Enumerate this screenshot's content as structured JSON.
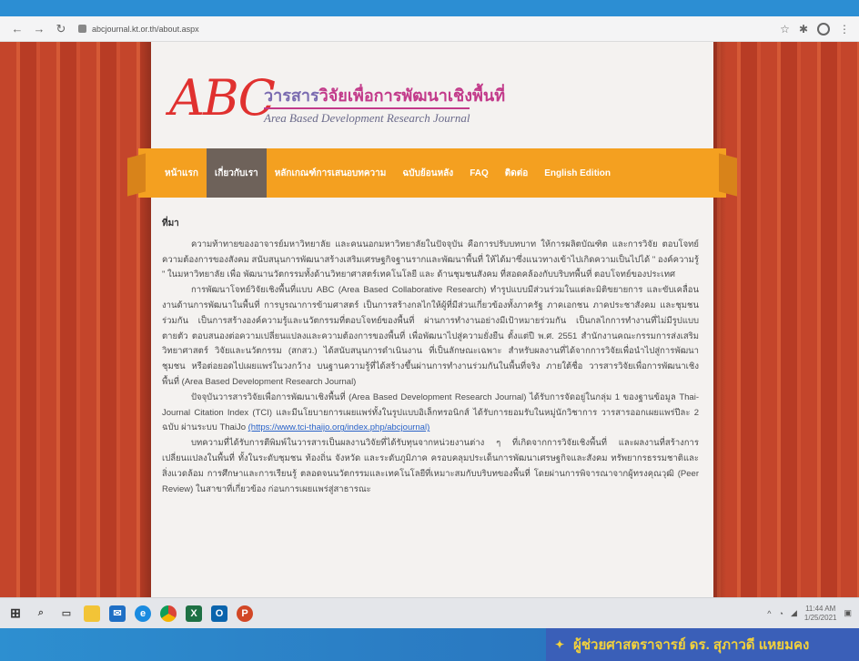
{
  "browser": {
    "back_icon": "back-arrow-icon",
    "forward_icon": "forward-arrow-icon",
    "reload_icon": "reload-icon",
    "url": "abcjournal.kt.or.th/about.aspx",
    "star_icon": "star-icon",
    "extension_icon": "extension-icon",
    "profile_icon": "profile-icon"
  },
  "site": {
    "logo_text": "ABC",
    "title_prefix": "วารสาร",
    "title_main": "วิจัยเพื่อการพัฒนาเชิงพื้นที่",
    "title_en": "Area Based Development Research Journal"
  },
  "menu": {
    "items": [
      "หน้าแรก",
      "เกี่ยวกับเรา",
      "หลักเกณฑ์การเสนอบทความ",
      "ฉบับย้อนหลัง",
      "FAQ",
      "ติดต่อ",
      "English Edition"
    ],
    "active_index": 1
  },
  "content": {
    "heading": "ที่มา",
    "p1": "ความท้าทายของอาจารย์มหาวิทยาลัย และคนนอกมหาวิทยาลัยในปัจจุบัน คือการปรับบทบาท ให้การผลิตบัณฑิต และการวิจัย ตอบโจทย์ความต้องการของสังคม สนับสนุนการพัฒนาสร้างเสริมเศรษฐกิจฐานรากและพัฒนาพื้นที่ ให้ได้มาซึ่งแนวทางเข้าไปเกิดความเป็นไปได้ \" องค์ความรู้ \" ในมหาวิทยาลัย เพื่อ พัฒนานวัตกรรมทั้งด้านวิทยาศาสตร์เทคโนโลยี และ ด้านชุมชนสังคม ที่สอดคล้องกับบริบทพื้นที่ ตอบโจทย์ของประเทศ",
    "p2": "การพัฒนาโจทย์วิจัยเชิงพื้นที่แบบ ABC (Area Based Collaborative Research) ทำรูปแบบมีส่วนร่วมในแต่ละมิติขยายการ และขับเคลื่อน งานด้านการพัฒนาในพื้นที่ การบูรณาการข้ามศาสตร์ เป็นการสร้างกลไกให้ผู้ที่มีส่วนเกี่ยวข้องทั้งภาครัฐ ภาคเอกชน ภาคประชาสังคม และชุมชนร่วมกัน เป็นการสร้างองค์ความรู้และนวัตกรรมที่ตอบโจทย์ของพื้นที่ ผ่านการทำงานอย่างมีเป้าหมายร่วมกัน เป็นกลไกการทำงานที่ไม่มีรูปแบบตายตัว ตอบสนองต่อความเปลี่ยนแปลงและความต้องการของพื้นที่ เพื่อพัฒนาไปสู่ความยั่งยืน ตั้งแต่ปี พ.ศ. 2551 สำนักงานคณะกรรมการส่งเสริมวิทยาศาสตร์ วิจัยและนวัตกรรม (สกสว.) ได้สนับสนุนการดำเนินงาน ที่เป็นลักษณะเฉพาะ สำหรับผลงานที่ได้จากการวิจัยเพื่อนำไปสู่การพัฒนาชุมชน หรือต่อยอดไปเผยแพร่ในวงกว้าง บนฐานความรู้ที่ได้สร้างขึ้นผ่านการทำงานร่วมกันในพื้นที่จริง ภายใต้ชื่อ วารสารวิจัยเพื่อการพัฒนาเชิงพื้นที่ (Area Based Development Research Journal)",
    "p3_before": "ปัจจุบันวารสารวิจัยเพื่อการพัฒนาเชิงพื้นที่ (Area Based Development Research Journal) ได้รับการจัดอยู่ในกลุ่ม 1 ของฐานข้อมูล Thai-Journal Citation Index (TCI) และมีนโยบายการเผยแพร่ทั้งในรูปแบบอิเล็กทรอนิกส์ ได้รับการยอมรับในหมู่นักวิชาการ วารสารออกเผยแพร่ปีละ 2 ฉบับ ผ่านระบบ ThaiJo",
    "p3_link": "(https://www.tci-thaijo.org/index.php/abcjournal)",
    "p4": "บทความที่ได้รับการตีพิมพ์ในวารสารเป็นผลงานวิจัยที่ได้รับทุนจากหน่วยงานต่าง ๆ ที่เกิดจากการวิจัยเชิงพื้นที่ และผลงานที่สร้างการเปลี่ยนแปลงในพื้นที่ ทั้งในระดับชุมชน ท้องถิ่น จังหวัด และระดับภูมิภาค ครอบคลุมประเด็นการพัฒนาเศรษฐกิจและสังคม ทรัพยากรธรรมชาติและสิ่งแวดล้อม การศึกษาและการเรียนรู้ ตลอดจนนวัตกรรมและเทคโนโลยีที่เหมาะสมกับบริบทของพื้นที่ โดยผ่านการพิจารณาจากผู้ทรงคุณวุฒิ (Peer Review) ในสาขาที่เกี่ยวข้อง ก่อนการเผยแพร่สู่สาธารณะ"
  },
  "taskbar": {
    "icons": [
      "windows-icon",
      "search-icon",
      "task-view-icon",
      "file-explorer-icon",
      "mail-icon",
      "edge-icon",
      "chrome-icon",
      "excel-icon",
      "outlook-icon",
      "powerpoint-icon"
    ],
    "time": "11:44 AM",
    "date": "1/25/2021"
  },
  "footer": {
    "presenter": "ผู้ช่วยศาสตราจารย์ ดร. สุภาวดี แหยมคง"
  },
  "colors": {
    "menu_bg": "#f4a020",
    "menu_active": "#6e625a",
    "logo_red": "#e0312f",
    "title_magenta": "#c23a8a",
    "footer_blue": "#2a6fb0",
    "presenter_yellow": "#f4d23a"
  }
}
